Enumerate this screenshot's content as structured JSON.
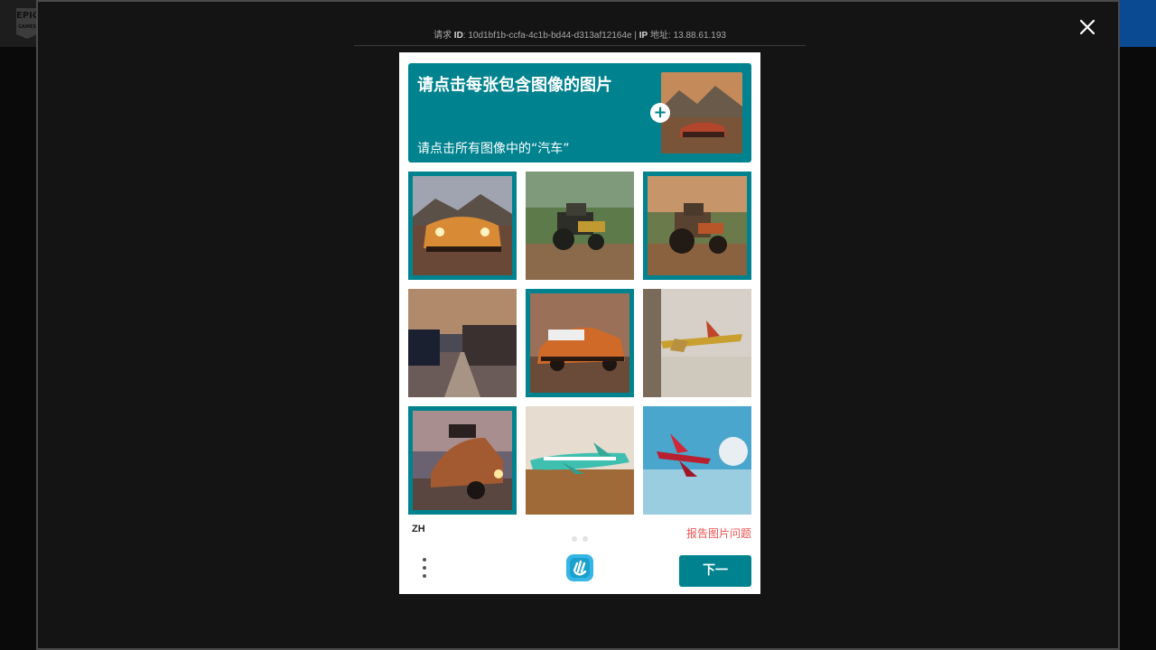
{
  "background_app": {
    "logo_text": "EPIC GAMES"
  },
  "modal": {
    "ray_id_label": "ID",
    "ray_id_prefix": "请求",
    "ray_id_value": "10d1bf1b-ccfa-4c1b-bd44-d313af12164e",
    "ip_label": "IP",
    "ip_suffix": "地址",
    "ip_value": "13.88.61.193"
  },
  "captcha": {
    "title": "请点击每张包含图像的图片",
    "subtitle": "请点击所有图像中的“汽车”",
    "example_icon": "plus-icon",
    "tiles": [
      {
        "subject": "orange-car",
        "selected": true
      },
      {
        "subject": "tractor",
        "selected": false
      },
      {
        "subject": "tractor",
        "selected": true
      },
      {
        "subject": "blurry-street",
        "selected": false
      },
      {
        "subject": "orange-muscle-car",
        "selected": true
      },
      {
        "subject": "toy-airplane",
        "selected": false
      },
      {
        "subject": "vintage-car",
        "selected": true
      },
      {
        "subject": "green-airplane",
        "selected": false
      },
      {
        "subject": "red-plane",
        "selected": false
      }
    ],
    "language": "ZH",
    "report_label": "报告图片问题",
    "next_label": "下一",
    "accent": "#00838f"
  }
}
